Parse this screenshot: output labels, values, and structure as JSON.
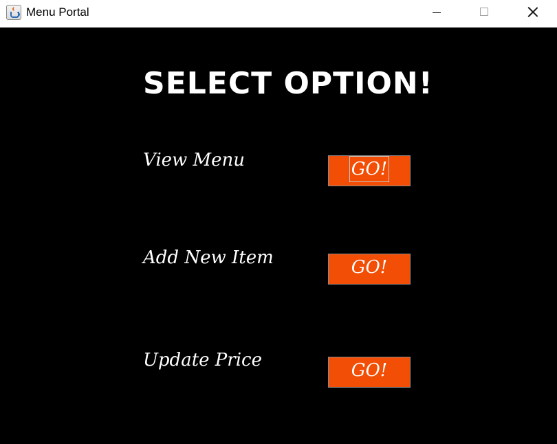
{
  "window": {
    "title": "Menu Portal",
    "app_icon": "java-cup-icon"
  },
  "page": {
    "heading": "Select Option!",
    "options": [
      {
        "label": "View Menu",
        "button": "GO!",
        "focused": true
      },
      {
        "label": "Add New Item",
        "button": "GO!",
        "focused": false
      },
      {
        "label": "Update Price",
        "button": "GO!",
        "focused": false
      }
    ]
  },
  "colors": {
    "background": "#000000",
    "text": "#ffffff",
    "button_bg": "#f24e05"
  }
}
